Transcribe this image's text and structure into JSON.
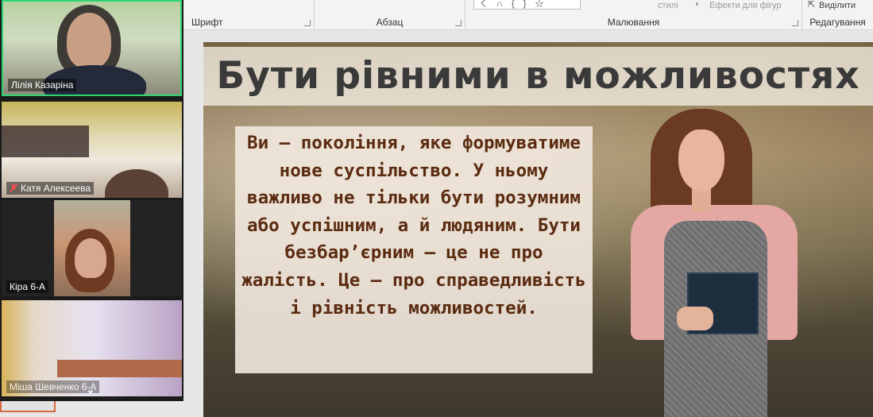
{
  "ribbon": {
    "groups": {
      "font": "Шрифт",
      "paragraph": "Абзац",
      "drawing": "Малювання",
      "editing": "Редагування"
    },
    "styles_label": "стилі",
    "shape_effects_label": "Ефекти для фігур",
    "select_label": "Виділити",
    "shapes_glyphs": "ㄑ ∩ { } ☆"
  },
  "participants": [
    {
      "name": "Лілія Казаріна",
      "muted": false,
      "active_speaker": true
    },
    {
      "name": "Катя Алексеева",
      "muted": true,
      "active_speaker": false
    },
    {
      "name": "Кіра 6-А",
      "muted": false,
      "active_speaker": false
    },
    {
      "name": "Міша Шевченко 6-А",
      "muted": false,
      "active_speaker": false
    }
  ],
  "slide": {
    "title": "Бути рівними в можливостях",
    "body": "Ви — покоління, яке формуватиме нове суспільство. У ньому важливо не тільки бути розумним або успішним, а й людяним. Бути безбар’єрним — це не про жалість. Це — про справедливість і рівність можливостей."
  },
  "colors": {
    "active_speaker_border": "#2ed573",
    "slide_text": "#5a2b10",
    "title_text": "#3a3a3a"
  }
}
